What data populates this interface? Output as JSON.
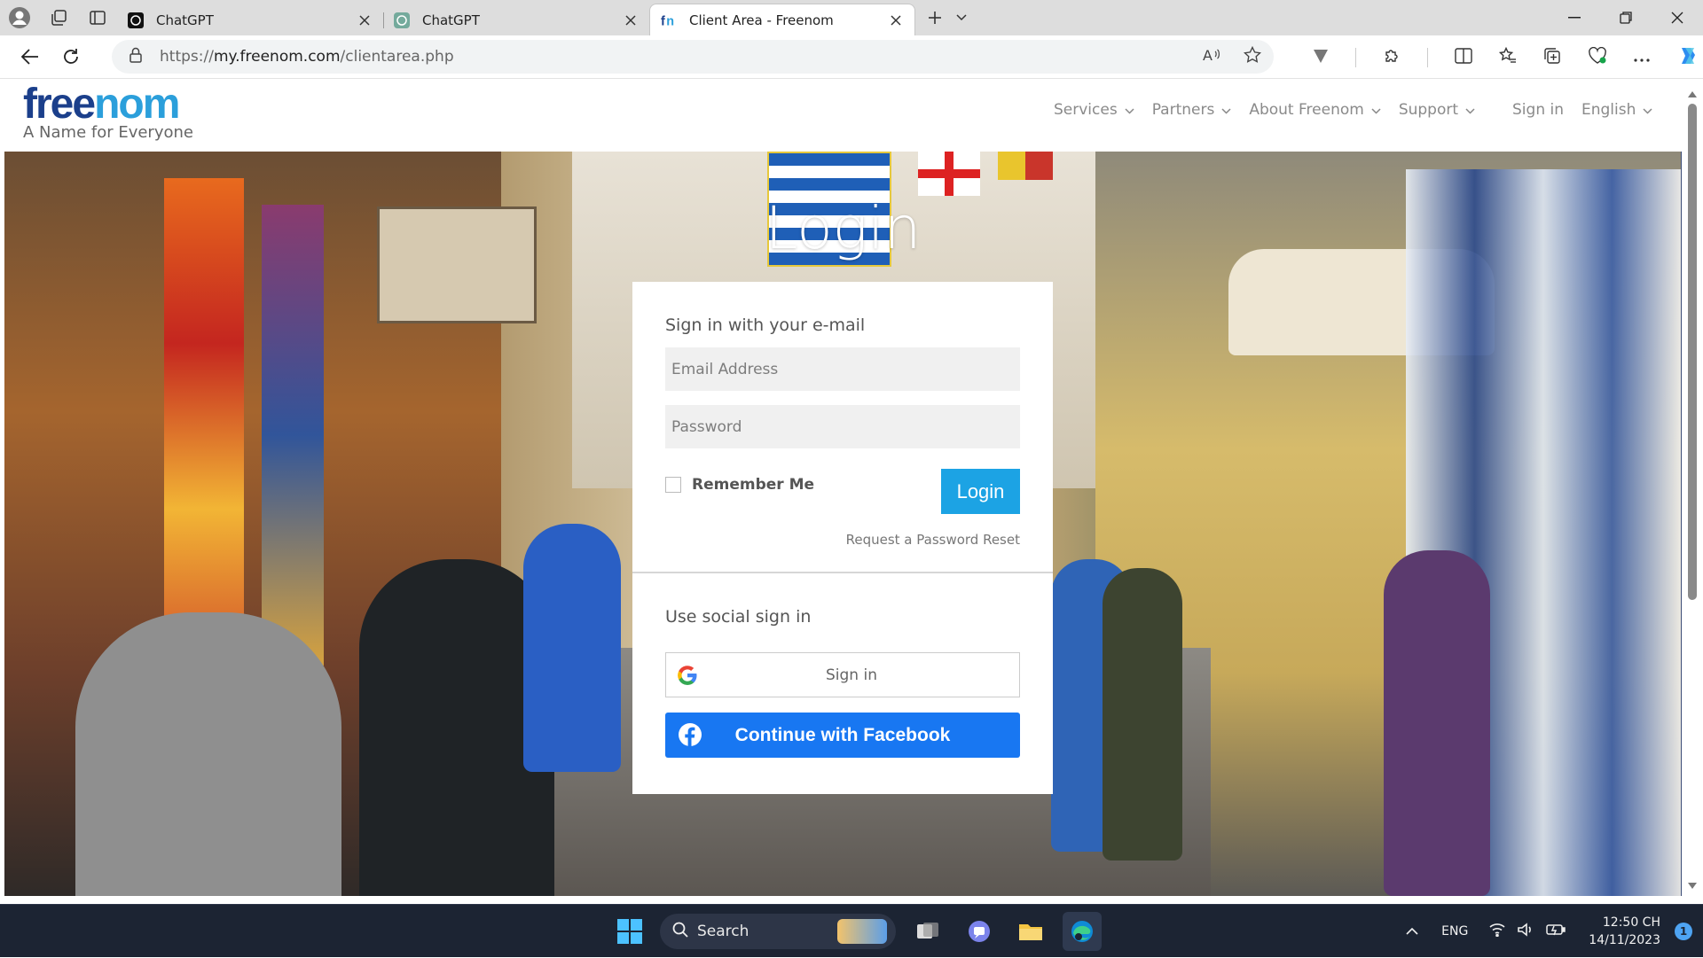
{
  "browser": {
    "tabs": [
      {
        "title": "ChatGPT",
        "favicon": "chatgpt-icon",
        "active": false
      },
      {
        "title": "ChatGPT",
        "favicon": "chatgpt-icon",
        "active": false
      },
      {
        "title": "Client Area - Freenom",
        "favicon": "freenom-icon",
        "active": true
      }
    ],
    "url_prefix": "https://",
    "url_host": "my.freenom.com",
    "url_path": "/clientarea.php"
  },
  "site": {
    "logo_text": "freenom",
    "tagline": "A Name for Everyone",
    "nav": [
      {
        "label": "Services"
      },
      {
        "label": "Partners"
      },
      {
        "label": "About Freenom"
      },
      {
        "label": "Support"
      }
    ],
    "sign_in": "Sign in",
    "language": "English"
  },
  "hero": {
    "title": "Login"
  },
  "login_card": {
    "email_heading": "Sign in with your e-mail",
    "email_placeholder": "Email Address",
    "password_placeholder": "Password",
    "remember_me": "Remember Me",
    "login_button": "Login",
    "reset_link": "Request a Password Reset",
    "social_heading": "Use social sign in",
    "google_button": "Sign in",
    "facebook_button": "Continue with Facebook"
  },
  "taskbar": {
    "search_label": "Search",
    "language": "ENG",
    "time": "12:50 CH",
    "date": "14/11/2023",
    "notification_count": "1"
  },
  "colors": {
    "accent": "#1ca3e4",
    "facebook": "#1877f2",
    "logo_dark": "#1b3f8b",
    "logo_light": "#2b9fdb",
    "taskbar": "#1c2433"
  }
}
